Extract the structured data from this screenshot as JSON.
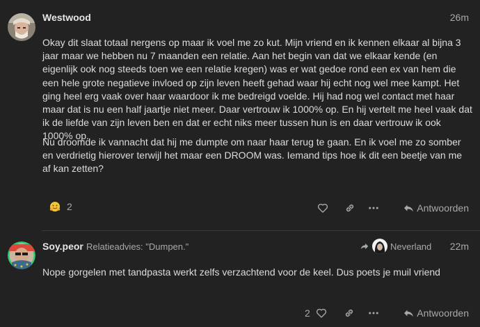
{
  "posts": [
    {
      "username": "Westwood",
      "time": "26m",
      "paragraphs": [
        "Okay dit slaat totaal nergens op maar ik voel me zo kut. Mijn vriend en ik kennen elkaar al bijna 3 jaar maar we hebben nu 7 maanden een relatie. Aan het begin van dat we elkaar kende (en eigenlijk ook nog steeds toen we een relatie kregen) was er wat gedoe rond een ex van hem die een hele grote negatieve invloed op zijn leven heeft gehad waar hij echt nog wel mee kampt. Het ging heel erg vaak over haar waardoor ik me bedreigd voelde. Hij had nog wel contact met haar maar dat is nu een half jaartje niet meer. Daar vertrouw ik 1000% op. En hij vertelt me heel vaak dat ik de liefde van zijn leven ben en dat er echt niks meer tussen hun is en daar vertrouw ik ook 1000% op.",
        "Nu droomde ik vannacht dat hij me dumpte om naar haar terug te gaan. En ik voel me zo somber en verdrietig hierover terwijl het maar een DROOM was. Iemand tips hoe ik dit een beetje van me af kan zetten?"
      ],
      "reaction_count": "2",
      "reply_label": "Antwoorden"
    },
    {
      "username": "Soy.peor",
      "reply_topic": "Relatieadvies: \"Dumpen.\"",
      "reply_to_user": "Neverland",
      "time": "22m",
      "paragraphs": [
        "Nope gorgelen met tandpasta werkt zelfs verzachtend voor de keel. Dus poets je muil vriend"
      ],
      "like_count": "2",
      "reply_label": "Antwoorden"
    }
  ],
  "icons": {
    "reaction": "hugging-face-icon",
    "like": "heart-icon",
    "share": "link-icon",
    "more": "ellipsis-icon",
    "reply": "reply-arrow-icon",
    "in_reply_to": "share-arrow-icon"
  },
  "colors": {
    "background": "#222222",
    "text": "#dddddd",
    "muted": "#a9a9a9",
    "avatar_ring": "#2ecc71"
  }
}
